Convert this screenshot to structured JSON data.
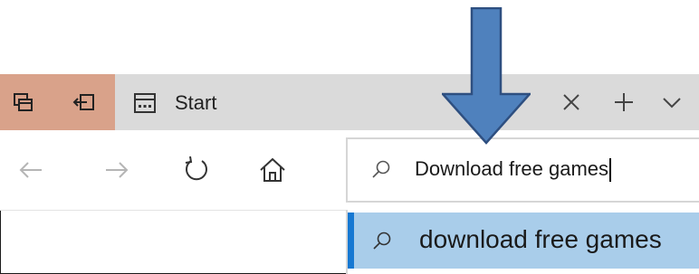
{
  "tabs": [
    {
      "title": "Start",
      "icon": "start-page-icon"
    }
  ],
  "tab_actions": {
    "icons": [
      "tab-preview-icon",
      "set-tabs-aside-icon"
    ],
    "accent_color": "#d9a28a"
  },
  "tab_controls": {
    "icons": [
      "close-icon",
      "plus-icon",
      "chevron-down-icon"
    ]
  },
  "nav": {
    "icons": [
      "back-arrow-icon",
      "forward-arrow-icon",
      "refresh-icon",
      "home-icon"
    ]
  },
  "address_bar": {
    "value": "Download free games",
    "icon": "search-icon"
  },
  "suggestions": [
    {
      "text": "download free games",
      "icon": "search-icon",
      "selected": true
    }
  ],
  "annotation": {
    "icon": "down-arrow-annotation",
    "color": "#4f81bd",
    "stroke": "#2e4f80"
  },
  "colors": {
    "selection_bg": "#a9cdea",
    "selection_accent": "#1678d2",
    "tabbar_bg": "#dadada"
  }
}
